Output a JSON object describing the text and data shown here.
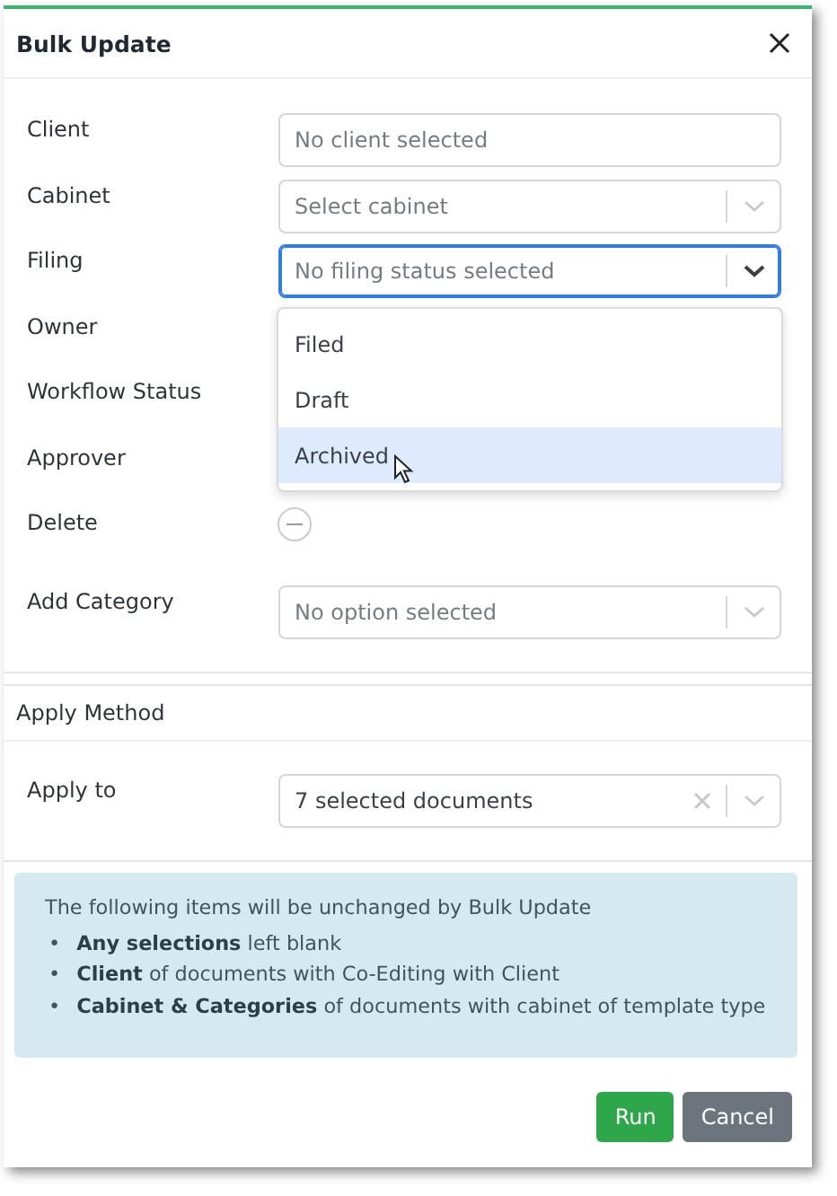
{
  "dialog": {
    "title": "Bulk Update"
  },
  "fields": [
    {
      "label": "Client",
      "kind": "input",
      "placeholder": "No client selected"
    },
    {
      "label": "Cabinet",
      "kind": "select",
      "placeholder": "Select cabinet",
      "focused": false
    },
    {
      "label": "Filing",
      "kind": "select",
      "placeholder": "No filing status selected",
      "focused": true,
      "open": true,
      "options": [
        {
          "label": "Filed",
          "selected": false
        },
        {
          "label": "Draft",
          "selected": false
        },
        {
          "label": "Archived",
          "selected": true
        }
      ]
    },
    {
      "label": "Owner",
      "kind": "covered"
    },
    {
      "label": "Workflow Status",
      "kind": "covered"
    },
    {
      "label": "Approver",
      "kind": "covered"
    },
    {
      "label": "Delete",
      "kind": "delete"
    },
    {
      "label": "Add Category",
      "kind": "select",
      "placeholder": "No option selected",
      "focused": false
    }
  ],
  "apply_method": {
    "title": "Apply Method",
    "label": "Apply to",
    "value": "7 selected documents",
    "clearable": true
  },
  "info": {
    "heading": "The following items will be unchanged by Bulk Update",
    "items": [
      {
        "bullet": "•",
        "text": "**Any selections** left blank"
      },
      {
        "bullet": "•",
        "text": "**Client** of documents with Co-Editing with Client"
      },
      {
        "bullet": "•",
        "text": "**Cabinet & Categories** of documents with cabinet of template type"
      }
    ]
  },
  "buttons": [
    {
      "label": "Run",
      "kind": "primary"
    },
    {
      "label": "Cancel",
      "kind": "secondary"
    }
  ]
}
